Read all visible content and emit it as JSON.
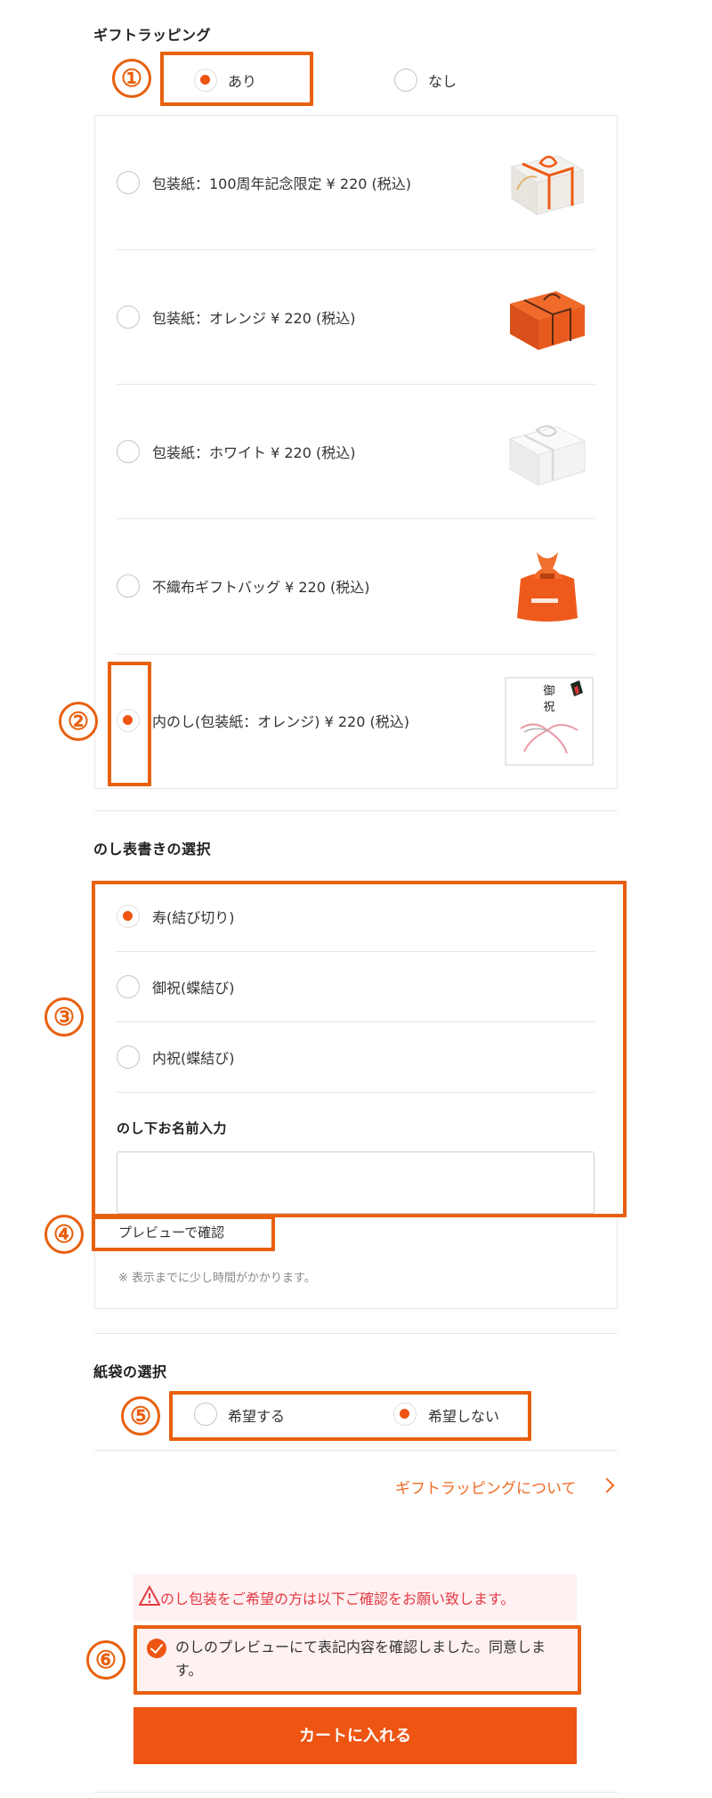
{
  "gift_wrapping": {
    "title": "ギフトラッピング",
    "options": [
      {
        "label": "あり",
        "selected": true
      },
      {
        "label": "なし",
        "selected": false
      }
    ],
    "papers": [
      {
        "label": "包装紙：100周年記念限定 ¥ 220 (税込)",
        "selected": false,
        "image": "white-gift-box-orange-ribbon"
      },
      {
        "label": "包装紙：オレンジ ¥ 220 (税込)",
        "selected": false,
        "image": "orange-gift-box"
      },
      {
        "label": "包装紙：ホワイト ¥ 220 (税込)",
        "selected": false,
        "image": "white-gift-box"
      },
      {
        "label": "不織布ギフトバッグ ¥ 220 (税込)",
        "selected": false,
        "image": "orange-gift-bag"
      },
      {
        "label": "内のし(包装紙：オレンジ) ¥ 220 (税込)",
        "selected": true,
        "image": "noshi-paper",
        "noshi_text": [
          "御",
          "祝"
        ]
      }
    ]
  },
  "noshi": {
    "title": "のし表書きの選択",
    "options": [
      {
        "label": "寿(結び切り)",
        "selected": true
      },
      {
        "label": "御祝(蝶結び)",
        "selected": false
      },
      {
        "label": "内祝(蝶結び)",
        "selected": false
      }
    ],
    "name_title": "のし下お名前入力",
    "name_value": "",
    "preview_button": "プレビューで確認",
    "note": "※ 表示までに少し時間がかかります。"
  },
  "paper_bag": {
    "title": "紙袋の選択",
    "options": [
      {
        "label": "希望する",
        "selected": false
      },
      {
        "label": "希望しない",
        "selected": true
      }
    ]
  },
  "about_link": "ギフトラッピングについて",
  "warning": "のし包装をご希望の方は以下ご確認をお願い致します。",
  "agreement": {
    "text": "のしのプレビューにて表記内容を確認しました。同意します。",
    "checked": true
  },
  "cart_button": "カートに入れる",
  "annotations": [
    "①",
    "②",
    "③",
    "④",
    "⑤",
    "⑥"
  ],
  "colors": {
    "accent": "#ee5412",
    "annotation": "#e8600e",
    "warning_text": "#e53a44",
    "warning_bg": "#fff1f1"
  }
}
